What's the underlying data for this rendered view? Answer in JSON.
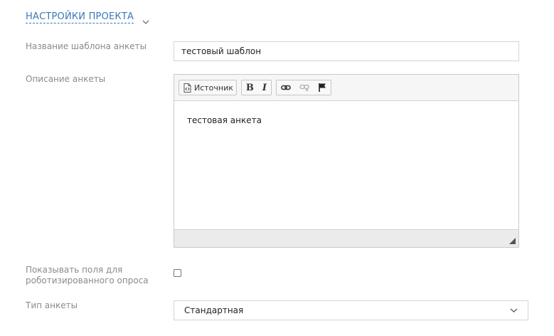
{
  "section": {
    "title": "НАСТРОЙКИ ПРОЕКТА"
  },
  "fields": {
    "template_name": {
      "label": "Название шаблона анкеты",
      "value": "тестовый шаблон"
    },
    "description": {
      "label": "Описание анкеты",
      "toolbar": {
        "source_label": "Источник",
        "bold_label": "B",
        "italic_label": "I"
      },
      "content": "тестовая анкета"
    },
    "robotized": {
      "label_line1": "Показывать поля для",
      "label_line2": "роботизированного опроса",
      "checked": false
    },
    "survey_type": {
      "label": "Тип анкеты",
      "selected": "Стандартная"
    }
  },
  "colors": {
    "accent": "#3a78b8",
    "label": "#8a8a8a"
  },
  "icons": [
    "chevron-down-icon",
    "source-icon",
    "link-icon",
    "unlink-icon",
    "flag-icon",
    "resize-grip-icon"
  ]
}
